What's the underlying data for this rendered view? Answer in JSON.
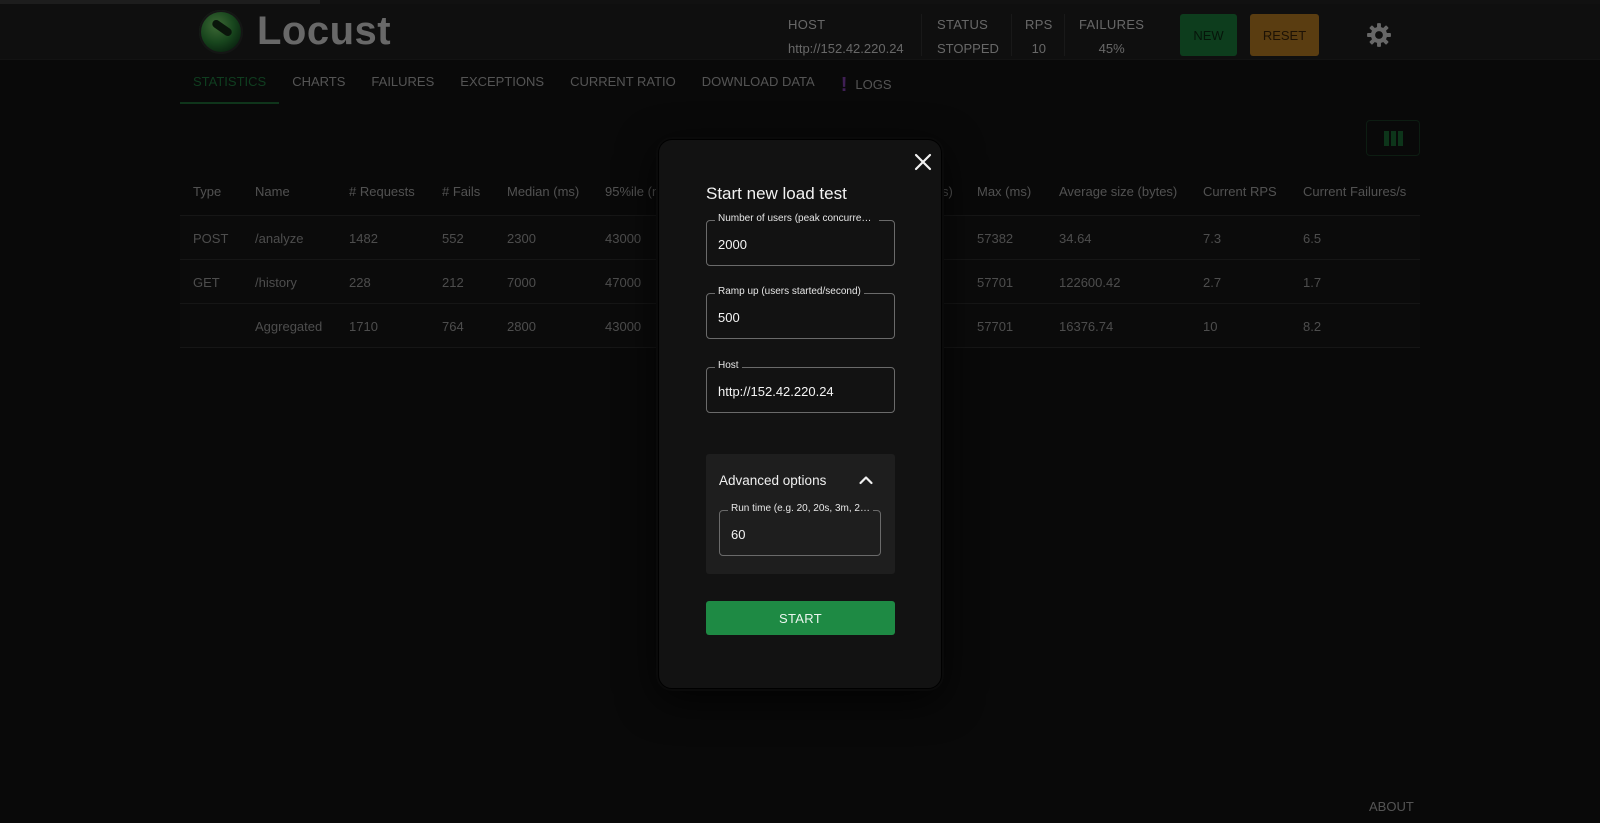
{
  "app": {
    "title": "Locust"
  },
  "header": {
    "host_label": "HOST",
    "host_value": "http://152.42.220.24",
    "status_label": "STATUS",
    "status_value": "STOPPED",
    "rps_label": "RPS",
    "rps_value": "10",
    "failures_label": "FAILURES",
    "failures_value": "45%",
    "new_label": "NEW",
    "reset_label": "RESET"
  },
  "tabs": [
    {
      "label": "STATISTICS"
    },
    {
      "label": "CHARTS"
    },
    {
      "label": "FAILURES"
    },
    {
      "label": "EXCEPTIONS"
    },
    {
      "label": "CURRENT RATIO"
    },
    {
      "label": "DOWNLOAD DATA"
    },
    {
      "label": "LOGS"
    }
  ],
  "table": {
    "headers": [
      "Type",
      "Name",
      "# Requests",
      "# Fails",
      "Median (ms)",
      "95%ile (n",
      "s)",
      "Max (ms)",
      "Average size (bytes)",
      "Current RPS",
      "Current Failures/s"
    ],
    "rows": [
      [
        "POST",
        "/analyze",
        "1482",
        "552",
        "2300",
        "43000",
        "",
        "57382",
        "34.64",
        "7.3",
        "6.5"
      ],
      [
        "GET",
        "/history",
        "228",
        "212",
        "7000",
        "47000",
        "",
        "57701",
        "122600.42",
        "2.7",
        "1.7"
      ],
      [
        "",
        "Aggregated",
        "1710",
        "764",
        "2800",
        "43000",
        "",
        "57701",
        "16376.74",
        "10",
        "8.2"
      ]
    ]
  },
  "footer": {
    "about_label": "ABOUT"
  },
  "modal": {
    "title": "Start new load test",
    "users_label": "Number of users (peak concurrency)",
    "users_value": "2000",
    "rampup_label": "Ramp up (users started/second)",
    "rampup_value": "500",
    "host_label": "Host",
    "host_value": "http://152.42.220.24",
    "advanced_label": "Advanced options",
    "runtime_label": "Run time (e.g. 20, 20s, 3m, 2…",
    "runtime_value": "60",
    "start_label": "START"
  },
  "colors": {
    "accent_green": "#1e8a44",
    "reset_orange": "#b57a22",
    "logs_warning_purple": "#7e3fa8"
  },
  "icons": [
    "logo-icon",
    "gear-icon",
    "columns-icon",
    "warning-icon",
    "close-icon",
    "chevron-up-icon"
  ]
}
